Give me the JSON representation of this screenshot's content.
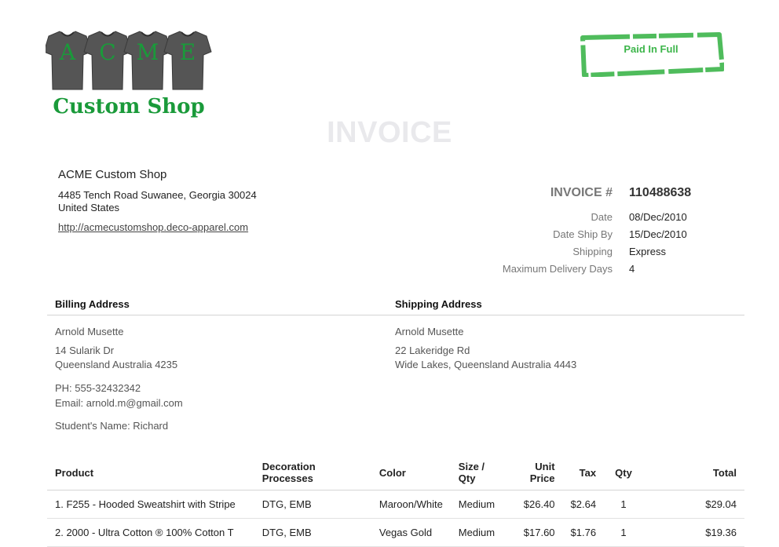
{
  "logo": {
    "letters": [
      "A",
      "C",
      "M",
      "E"
    ],
    "tagline": "Custom Shop",
    "shirt_color": "#555555",
    "brand_color": "#1a9a3a"
  },
  "stamp": {
    "text": "Paid In Full",
    "color": "#3cb54a"
  },
  "heading": "INVOICE",
  "company": {
    "name": "ACME Custom Shop",
    "address_line1": "4485 Tench Road Suwanee, Georgia 30024",
    "address_line2": "United States",
    "url": "http://acmecustomshop.deco-apparel.com"
  },
  "invoice": {
    "number_label": "INVOICE #",
    "number": "110488638",
    "fields": [
      {
        "label": "Date",
        "value": "08/Dec/2010"
      },
      {
        "label": "Date Ship By",
        "value": "15/Dec/2010"
      },
      {
        "label": "Shipping",
        "value": "Express"
      },
      {
        "label": "Maximum Delivery Days",
        "value": "4"
      }
    ]
  },
  "billing": {
    "heading": "Billing Address",
    "name": "Arnold Musette",
    "street": "14 Sularik Dr",
    "city": "Queensland Australia 4235",
    "phone": "PH: 555-32432342",
    "email": "Email: arnold.m@gmail.com",
    "student": "Student's Name: Richard"
  },
  "shipping": {
    "heading": "Shipping Address",
    "name": "Arnold Musette",
    "street": "22 Lakeridge Rd",
    "city": "Wide Lakes, Queensland Australia 4443"
  },
  "table": {
    "headers": {
      "product": "Product",
      "decoration_1": "Decoration",
      "decoration_2": "Processes",
      "color": "Color",
      "size_1": "Size /",
      "size_2": "Qty",
      "unit_1": "Unit",
      "unit_2": "Price",
      "tax": "Tax",
      "qty": "Qty",
      "total": "Total"
    },
    "rows": [
      {
        "product": "1. F255 - Hooded Sweatshirt with Stripe",
        "decoration": "DTG, EMB",
        "color": "Maroon/White",
        "size": "Medium",
        "unit_price": "$26.40",
        "tax": "$2.64",
        "qty": "1",
        "total": "$29.04"
      },
      {
        "product": "2. 2000 - Ultra Cotton ® 100% Cotton T",
        "decoration": "DTG, EMB",
        "color": "Vegas Gold",
        "size": "Medium",
        "unit_price": "$17.60",
        "tax": "$1.76",
        "qty": "1",
        "total": "$19.36"
      }
    ]
  }
}
